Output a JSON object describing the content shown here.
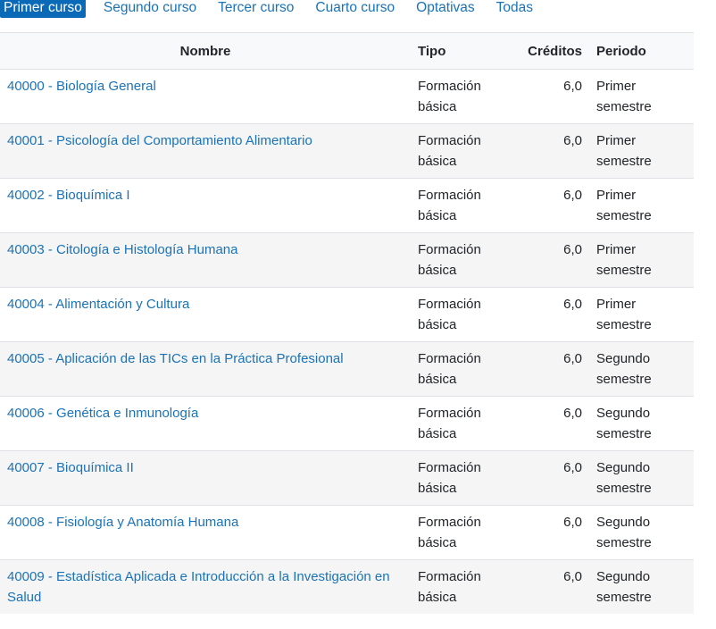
{
  "tabs": [
    {
      "label": "Primer curso",
      "active": true
    },
    {
      "label": "Segundo curso",
      "active": false
    },
    {
      "label": "Tercer curso",
      "active": false
    },
    {
      "label": "Cuarto curso",
      "active": false
    },
    {
      "label": "Optativas",
      "active": false
    },
    {
      "label": "Todas",
      "active": false
    }
  ],
  "table": {
    "headers": {
      "nombre": "Nombre",
      "tipo": "Tipo",
      "creditos": "Créditos",
      "periodo": "Periodo"
    },
    "rows": [
      {
        "nombre": "40000 - Biología General",
        "tipo": "Formación básica",
        "creditos": "6,0",
        "periodo": "Primer semestre"
      },
      {
        "nombre": "40001 - Psicología del Comportamiento Alimentario",
        "tipo": "Formación básica",
        "creditos": "6,0",
        "periodo": "Primer semestre"
      },
      {
        "nombre": "40002 - Bioquímica I",
        "tipo": "Formación básica",
        "creditos": "6,0",
        "periodo": "Primer semestre"
      },
      {
        "nombre": "40003 - Citología e Histología Humana",
        "tipo": "Formación básica",
        "creditos": "6,0",
        "periodo": "Primer semestre"
      },
      {
        "nombre": "40004 - Alimentación y Cultura",
        "tipo": "Formación básica",
        "creditos": "6,0",
        "periodo": "Primer semestre"
      },
      {
        "nombre": "40005 - Aplicación de las TICs en la Práctica Profesional",
        "tipo": "Formación básica",
        "creditos": "6,0",
        "periodo": "Segundo semestre"
      },
      {
        "nombre": "40006 - Genética e Inmunología",
        "tipo": "Formación básica",
        "creditos": "6,0",
        "periodo": "Segundo semestre"
      },
      {
        "nombre": "40007 - Bioquímica II",
        "tipo": "Formación básica",
        "creditos": "6,0",
        "periodo": "Segundo semestre"
      },
      {
        "nombre": "40008 - Fisiología y Anatomía Humana",
        "tipo": "Formación básica",
        "creditos": "6,0",
        "periodo": "Segundo semestre"
      },
      {
        "nombre": "40009 - Estadística Aplicada e Introducción a la Investigación en Salud",
        "tipo": "Formación básica",
        "creditos": "6,0",
        "periodo": "Segundo semestre"
      }
    ]
  },
  "colors": {
    "link": "#1a73b8",
    "active_tab_bg": "#0a6ab8",
    "header_bg": "#f8f9fa",
    "row_stripe": "#f5f5f5",
    "border": "#dee2e6"
  }
}
